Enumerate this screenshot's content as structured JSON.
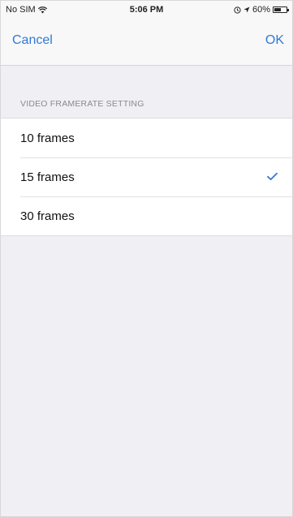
{
  "status_bar": {
    "carrier": "No SIM",
    "time": "5:06 PM",
    "battery": "60%",
    "battery_level": 0.6
  },
  "nav": {
    "cancel_label": "Cancel",
    "ok_label": "OK"
  },
  "section": {
    "header": "VIDEO FRAMERATE SETTING",
    "options": [
      {
        "label": "10 frames",
        "selected": false
      },
      {
        "label": "15 frames",
        "selected": true
      },
      {
        "label": "30 frames",
        "selected": false
      }
    ]
  },
  "colors": {
    "accent": "#2f7ad6",
    "background": "#efeff4",
    "text": "#111111",
    "section_header": "#8a8a8f"
  },
  "icons": [
    "wifi-icon",
    "alarm-icon",
    "location-icon",
    "battery-icon",
    "checkmark-icon"
  ]
}
